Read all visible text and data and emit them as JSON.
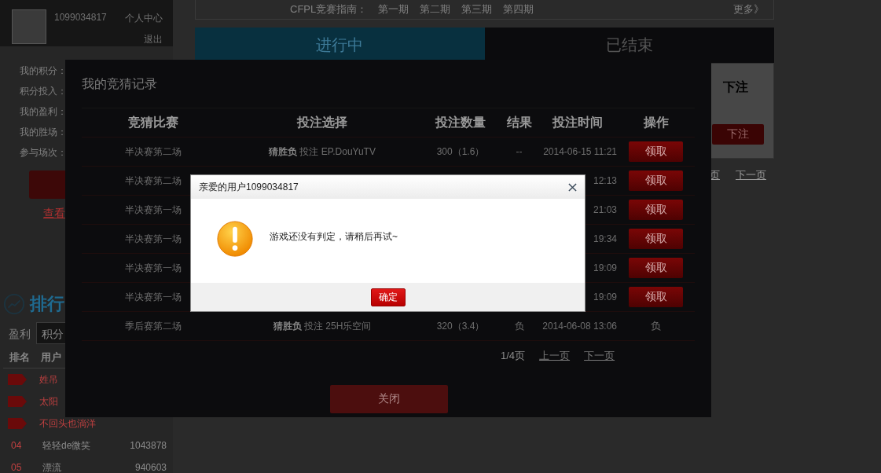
{
  "user": {
    "id": "1099034817",
    "links": [
      "个人中心",
      "退出"
    ]
  },
  "stats": [
    "我的积分：",
    "积分投入：",
    "我的盈利：",
    "我的胜场：",
    "参与场次："
  ],
  "view_link": "查看",
  "ranking": {
    "title": "排行",
    "tabs": [
      {
        "label": "盈利",
        "selected": false
      },
      {
        "label": "积分",
        "selected": true
      }
    ],
    "columns": [
      "排名",
      "用户"
    ],
    "rows": [
      {
        "rank": "",
        "tag": true,
        "user": "姓吊",
        "value": ""
      },
      {
        "rank": "",
        "tag": true,
        "user": "太阳",
        "value": ""
      },
      {
        "rank": "",
        "tag": true,
        "user": "不回头也淌洋",
        "value": ""
      },
      {
        "rank": "04",
        "tag": false,
        "user": "轻轻de微笑",
        "value": "1043878"
      },
      {
        "rank": "05",
        "tag": false,
        "user": "漂流",
        "value": "940603"
      }
    ]
  },
  "guide": {
    "label": "CFPL竞赛指南：",
    "items": [
      "第一期",
      "第二期",
      "第三期",
      "第四期"
    ],
    "more": "更多》"
  },
  "tabs": [
    {
      "label": "进行中",
      "selected": true
    },
    {
      "label": "已结束",
      "selected": false
    }
  ],
  "bet_panel": {
    "header": "下注",
    "button": "下注",
    "pager": [
      "页",
      "下一页"
    ]
  },
  "records": {
    "title": "我的竞猜记录",
    "columns": [
      "竞猜比赛",
      "投注选择",
      "投注数量",
      "结果",
      "投注时间",
      "操作"
    ],
    "rows": [
      {
        "match": "半决赛第二场",
        "choice": "**猜胜负** 投注 EP.DouYuTV",
        "amount": "300（1.6）",
        "result": "--",
        "time": "2014-06-15 11:21",
        "action": {
          "kind": "button",
          "label": "领取"
        }
      },
      {
        "match": "半决赛第二场",
        "choice": "",
        "amount": "",
        "result": "",
        "time": "12:13",
        "action": {
          "kind": "button",
          "label": "领取"
        }
      },
      {
        "match": "半决赛第一场",
        "choice": "",
        "amount": "",
        "result": "",
        "time": "21:03",
        "action": {
          "kind": "button",
          "label": "领取"
        }
      },
      {
        "match": "半决赛第一场",
        "choice": "",
        "amount": "",
        "result": "",
        "time": "19:34",
        "action": {
          "kind": "button",
          "label": "领取"
        }
      },
      {
        "match": "半决赛第一场",
        "choice": "",
        "amount": "",
        "result": "",
        "time": "19:09",
        "action": {
          "kind": "button",
          "label": "领取"
        }
      },
      {
        "match": "半决赛第一场",
        "choice": "",
        "amount": "",
        "result": "",
        "time": "19:09",
        "action": {
          "kind": "button",
          "label": "领取"
        }
      },
      {
        "match": "季后赛第二场",
        "choice": "**猜胜负** 投注 25H乐空间",
        "amount": "320（3.4）",
        "result": "负",
        "time": "2014-06-08 13:06",
        "action": {
          "kind": "text",
          "label": "负"
        }
      }
    ],
    "pager": {
      "info": "1/4页",
      "prev": "上一页",
      "next": "下一页"
    },
    "close": "关闭"
  },
  "alert": {
    "title": "亲爱的用户1099034817",
    "message": "游戏还没有判定，请稍后再试~",
    "ok": "确定"
  }
}
